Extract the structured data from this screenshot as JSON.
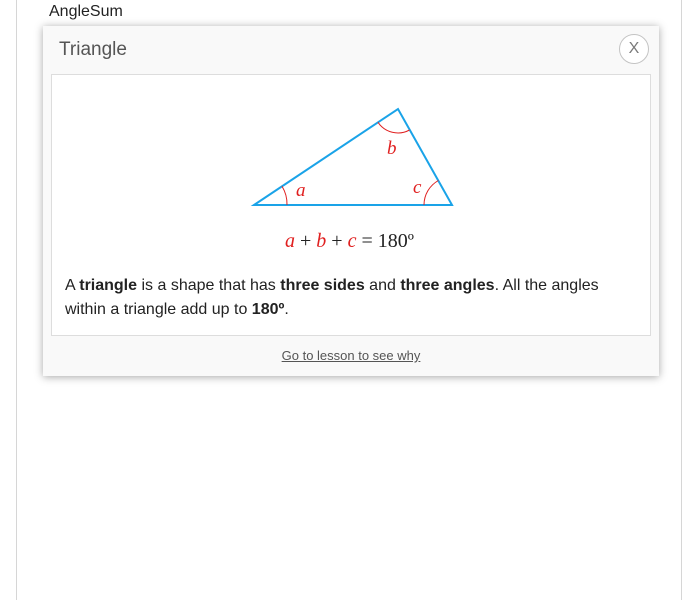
{
  "page": {
    "label": "AngleSum"
  },
  "modal": {
    "title": "Triangle",
    "close_label": "X",
    "diagram": {
      "angle_labels": [
        "a",
        "b",
        "c"
      ],
      "equation": {
        "terms": [
          "a",
          "b",
          "c"
        ],
        "plus": "+",
        "equals": "=",
        "total": "180º"
      },
      "colors": {
        "triangle": "#1aa3e8",
        "angle": "#e02020",
        "text": "#222222"
      }
    },
    "description": {
      "t1": "A ",
      "b1": "triangle",
      "t2": " is a shape that has ",
      "b2": "three sides",
      "t3": " and ",
      "b3": "three angles",
      "t4": ". All the angles within a triangle add up to ",
      "b4": "180º",
      "t5": "."
    },
    "link": "Go to lesson to see why"
  }
}
